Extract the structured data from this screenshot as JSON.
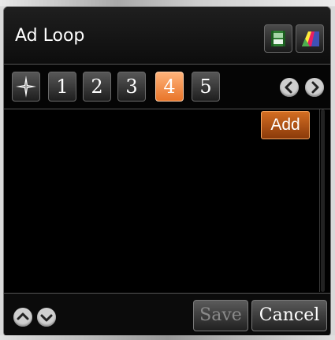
{
  "title": "Ad Loop",
  "toolbar": {
    "icons": [
      "film-icon",
      "color-palette-icon"
    ]
  },
  "tabs": {
    "special_icon": "compass-star-icon",
    "items": [
      "1",
      "2",
      "3",
      "4",
      "5"
    ],
    "active_index": 3,
    "nav": [
      "chevron-left-icon",
      "chevron-right-icon"
    ]
  },
  "add_label": "Add",
  "footer": {
    "up_icon": "chevron-up-icon",
    "down_icon": "chevron-down-icon",
    "save_label": "Save",
    "cancel_label": "Cancel"
  },
  "colors": {
    "accent_orange": "#e8752a",
    "add_orange": "#c0601b",
    "panel_bg": "#000000"
  }
}
